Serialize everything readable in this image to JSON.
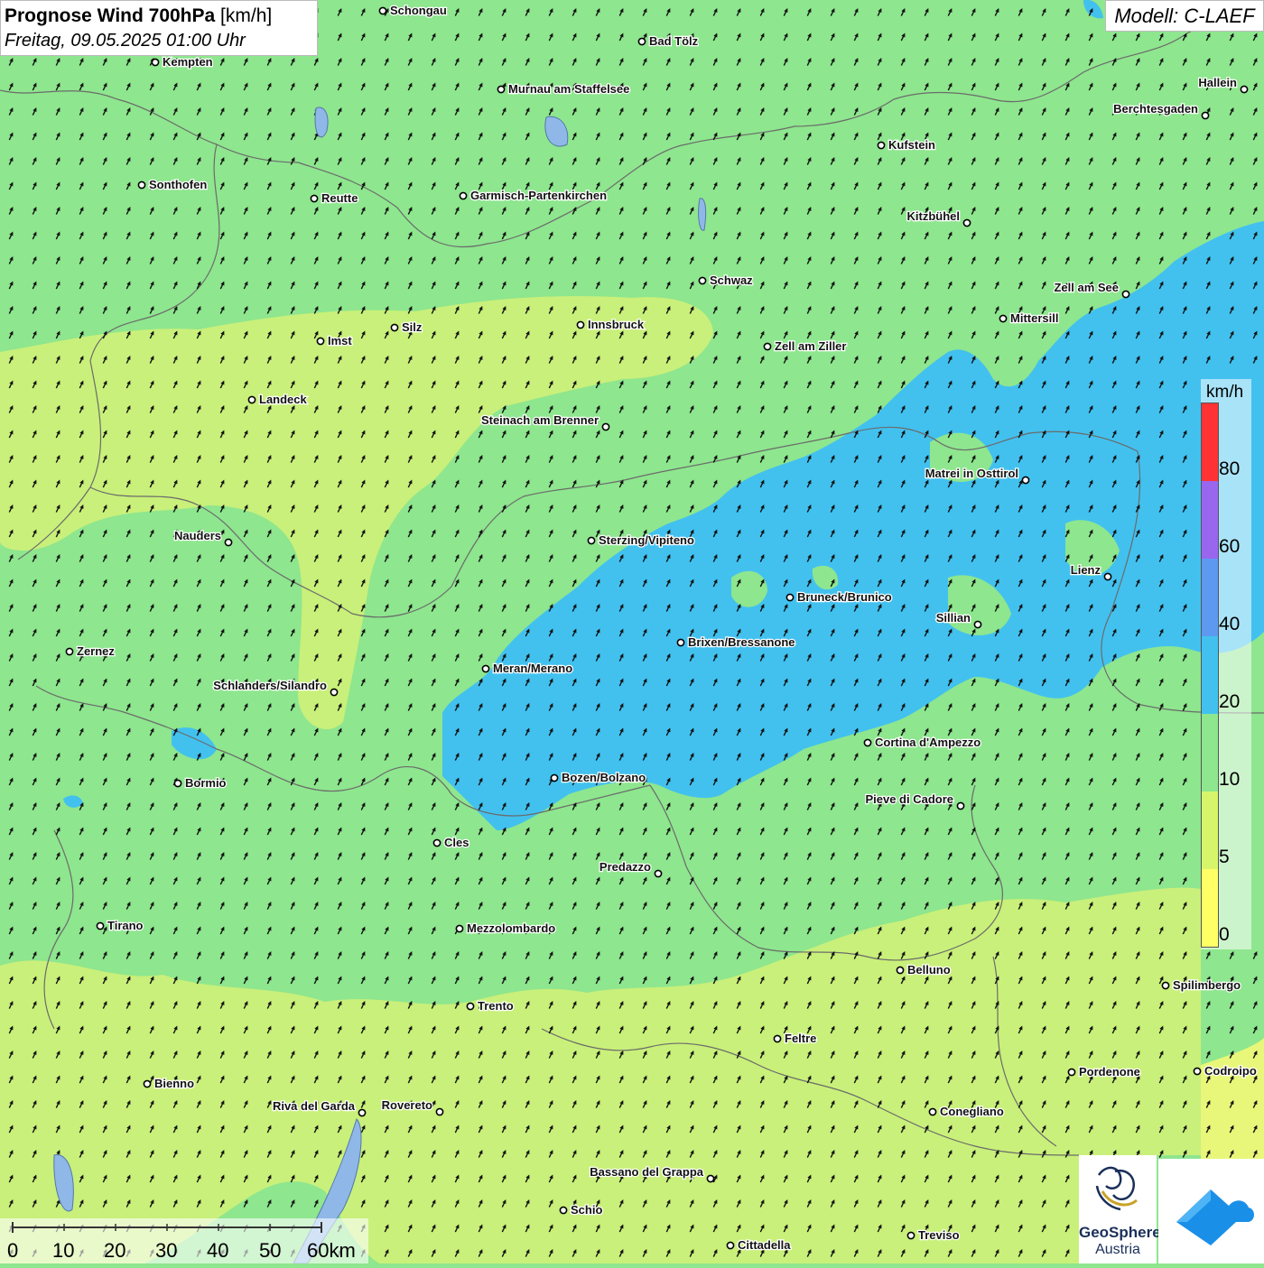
{
  "header": {
    "title_bold": "Prognose Wind 700hPa",
    "title_unit": "[km/h]",
    "subtitle": "Freitag, 09.05.2025 01:00 Uhr",
    "model": "Modell: C-LAEF"
  },
  "legend": {
    "unit": "km/h",
    "classes": [
      {
        "label": "0",
        "color": "#ffff66"
      },
      {
        "label": "5",
        "color": "#d7f56a"
      },
      {
        "label": "10",
        "color": "#8ee68e"
      },
      {
        "label": "20",
        "color": "#42c1ef"
      },
      {
        "label": "40",
        "color": "#5e99f0"
      },
      {
        "label": "60",
        "color": "#9966ee"
      },
      {
        "label": "80",
        "color": "#ff3333"
      }
    ]
  },
  "scale": {
    "labels": [
      "0",
      "10",
      "20",
      "30",
      "40",
      "50",
      "60km"
    ]
  },
  "logo": {
    "name": "GeoSphere",
    "sub": "Austria"
  },
  "wind": {
    "direction_deg": 25,
    "pattern": "predominantly SSW wind, arrows pointing north-northeast"
  },
  "cities": [
    {
      "name": "Schongau"
    },
    {
      "name": "Bad Tölz"
    },
    {
      "name": "Kempten"
    },
    {
      "name": "Murnau am Staffelsee"
    },
    {
      "name": "Hallein"
    },
    {
      "name": "Berchtesgaden"
    },
    {
      "name": "Kufstein"
    },
    {
      "name": "Sonthofen"
    },
    {
      "name": "Reutte"
    },
    {
      "name": "Garmisch-Partenkirchen"
    },
    {
      "name": "Kitzbühel"
    },
    {
      "name": "Schwaz"
    },
    {
      "name": "Zell am See"
    },
    {
      "name": "Mittersill"
    },
    {
      "name": "Innsbruck"
    },
    {
      "name": "Silz"
    },
    {
      "name": "Imst"
    },
    {
      "name": "Zell am Ziller"
    },
    {
      "name": "Landeck"
    },
    {
      "name": "Steinach am Brenner"
    },
    {
      "name": "Matrei in Osttirol"
    },
    {
      "name": "Nauders"
    },
    {
      "name": "Sterzing/Vipiteno"
    },
    {
      "name": "Lienz"
    },
    {
      "name": "Bruneck/Brunico"
    },
    {
      "name": "Sillian"
    },
    {
      "name": "Zernez"
    },
    {
      "name": "Brixen/Bressanone"
    },
    {
      "name": "Meran/Merano"
    },
    {
      "name": "Schlanders/Silandro"
    },
    {
      "name": "Cortina d'Ampezzo"
    },
    {
      "name": "Bozen/Bolzano"
    },
    {
      "name": "Bormio"
    },
    {
      "name": "Pieve di Cadore"
    },
    {
      "name": "Cles"
    },
    {
      "name": "Predazzo"
    },
    {
      "name": "Tirano"
    },
    {
      "name": "Mezzolombardo"
    },
    {
      "name": "Belluno"
    },
    {
      "name": "Spilimbergo"
    },
    {
      "name": "Trento"
    },
    {
      "name": "Feltre"
    },
    {
      "name": "Bienno"
    },
    {
      "name": "Pordenone"
    },
    {
      "name": "Codroipo"
    },
    {
      "name": "Riva del Garda"
    },
    {
      "name": "Rovereto"
    },
    {
      "name": "Conegliano"
    },
    {
      "name": "Bassano del Grappa"
    },
    {
      "name": "Schio"
    },
    {
      "name": "Treviso"
    },
    {
      "name": "Cittadella"
    }
  ]
}
